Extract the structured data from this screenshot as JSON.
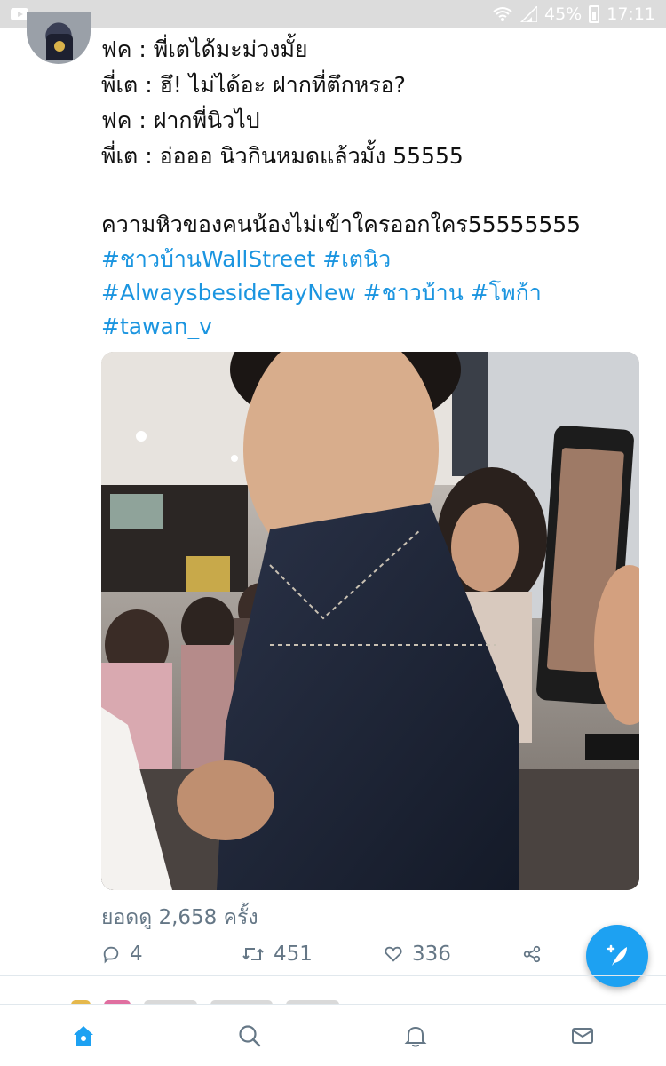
{
  "status_bar": {
    "battery": "45%",
    "time": "17:11"
  },
  "tweet": {
    "lines": [
      "ฟค : พี่เตได้มะม่วงมั้ย",
      "พี่เต : ฮึ! ไม่ได้อะ ฝากที่ตึกหรอ?",
      "ฟค : ฝากพี่นิวไป",
      "พี่เต : อ่อออ นิวกินหมดแล้วมั้ง 55555",
      "ความหิวของคนน้องไม่เข้าใครออกใคร55555555"
    ],
    "hashtags": [
      "#ชาวบ้านWallStreet",
      "#เตนิว",
      "#AlwaysbesideTayNew",
      "#ชาวบ้าน",
      "#โพก้า",
      "#tawan_v"
    ],
    "views": "ยอดดู 2,658 ครั้ง",
    "reply_count": "4",
    "retweet_count": "451",
    "like_count": "336"
  },
  "icons": {
    "reply": "reply-icon",
    "retweet": "retweet-icon",
    "like": "heart-icon",
    "share": "share-icon",
    "compose": "compose-tweet-icon",
    "home": "home-icon",
    "search": "search-icon",
    "notifications": "bell-icon",
    "messages": "envelope-icon"
  },
  "colors": {
    "accent": "#1da1f2",
    "hashtag": "#1b95e0",
    "muted": "#657786"
  }
}
